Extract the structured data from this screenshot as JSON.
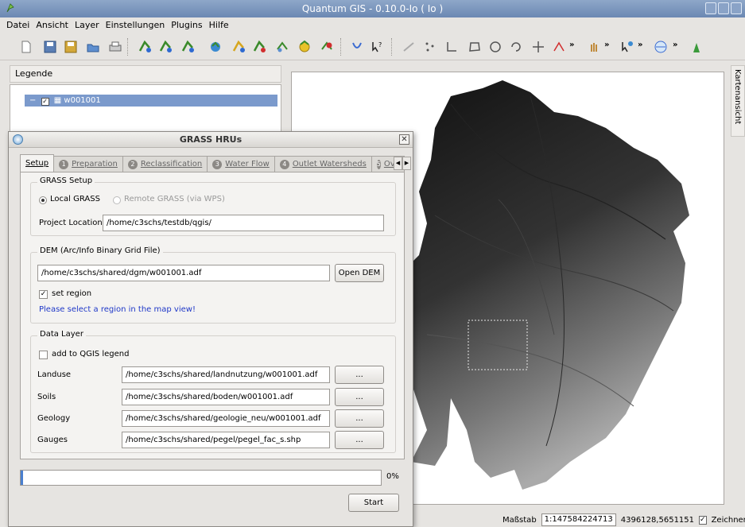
{
  "window": {
    "title": "Quantum GIS - 0.10.0-Io ( Io )"
  },
  "menu": [
    "Datei",
    "Ansicht",
    "Layer",
    "Einstellungen",
    "Plugins",
    "Hilfe"
  ],
  "toolbar": {
    "icons": [
      "new-project-icon",
      "save-icon",
      "save-as-icon",
      "open-icon",
      "print-icon",
      "add-vector-icon",
      "add-raster-icon",
      "add-layer-icon",
      "add-wms-icon",
      "add-postgis-icon",
      "remove-layer-icon",
      "plugin-icon",
      "plugin-icon",
      "plugin-icon",
      "help-icon",
      "capture-line-icon",
      "capture-point-icon",
      "capture-polygon-icon",
      "edit-polygon-icon",
      "rotate-icon",
      "refresh-icon",
      "move-icon",
      "node-icon",
      "pan-icon",
      "zoom-icon",
      "identify-icon",
      "globe-icon"
    ],
    "more": "»"
  },
  "legend": {
    "header": "Legende",
    "layer": "w001001"
  },
  "map_side_tab": "Kartenansicht",
  "status": {
    "scale_label": "Maßstab",
    "scale_value": "1:147584224713",
    "coords": "4396128,5651151",
    "render_label": "Zeichnen"
  },
  "dialog": {
    "title": "GRASS HRUs",
    "tabs": [
      {
        "num": "",
        "label": "Setup",
        "active": true
      },
      {
        "num": "1",
        "label": "Preparation"
      },
      {
        "num": "2",
        "label": "Reclassification"
      },
      {
        "num": "3",
        "label": "Water Flow"
      },
      {
        "num": "4",
        "label": "Outlet Watersheds"
      },
      {
        "num": "5",
        "label": "Overl"
      }
    ],
    "grass_setup": {
      "title": "GRASS Setup",
      "local": "Local GRASS",
      "remote": "Remote GRASS (via WPS)",
      "project_label": "Project Location",
      "project_value": "/home/c3schs/testdb/qgis/"
    },
    "dem": {
      "title": "DEM (Arc/Info Binary Grid File)",
      "path": "/home/c3schs/shared/dgm/w001001.adf",
      "open_button": "Open DEM",
      "set_region": "set region",
      "hint": "Please select a region in the map view!"
    },
    "data_layer": {
      "title": "Data Layer",
      "add_legend": "add to QGIS legend",
      "browse": "...",
      "rows": [
        {
          "label": "Landuse",
          "path": "/home/c3schs/shared/landnutzung/w001001.adf"
        },
        {
          "label": "Soils",
          "path": "/home/c3schs/shared/boden/w001001.adf"
        },
        {
          "label": "Geology",
          "path": "/home/c3schs/shared/geologie_neu/w001001.adf"
        },
        {
          "label": "Gauges",
          "path": "/home/c3schs/shared/pegel/pegel_fac_s.shp"
        }
      ]
    },
    "progress": {
      "value": 0,
      "text": "0%"
    },
    "start_button": "Start"
  }
}
